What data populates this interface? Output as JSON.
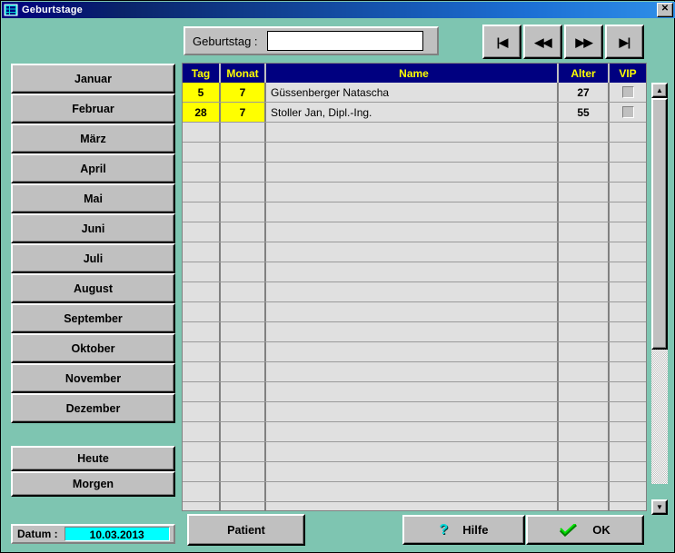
{
  "window": {
    "title": "Geburtstage",
    "icon": "list-table-icon",
    "close_label": "✕"
  },
  "search": {
    "label": "Geburtstag :",
    "value": "",
    "placeholder": ""
  },
  "nav": {
    "first": "|◀",
    "prev": "◀◀",
    "next": "▶▶",
    "last": "▶|"
  },
  "months": [
    {
      "label": "Januar"
    },
    {
      "label": "Februar"
    },
    {
      "label": "März"
    },
    {
      "label": "April"
    },
    {
      "label": "Mai"
    },
    {
      "label": "Juni"
    },
    {
      "label": "Juli"
    },
    {
      "label": "August"
    },
    {
      "label": "September"
    },
    {
      "label": "Oktober"
    },
    {
      "label": "November"
    },
    {
      "label": "Dezember"
    }
  ],
  "quick_days": [
    {
      "label": "Heute"
    },
    {
      "label": "Morgen"
    }
  ],
  "datum": {
    "label": "Datum :",
    "value": "10.03.2013"
  },
  "grid": {
    "columns": [
      {
        "key": "tag",
        "label": "Tag"
      },
      {
        "key": "monat",
        "label": "Monat"
      },
      {
        "key": "name",
        "label": "Name"
      },
      {
        "key": "alter",
        "label": "Alter"
      },
      {
        "key": "vip",
        "label": "VIP"
      }
    ],
    "rows": [
      {
        "tag": "5",
        "monat": "7",
        "name": "Güssenberger Natascha",
        "alter": "27",
        "vip": false
      },
      {
        "tag": "28",
        "monat": "7",
        "name": "Stoller Jan, Dipl.-Ing.",
        "alter": "55",
        "vip": false
      }
    ],
    "empty_row_count": 20
  },
  "scrollbar": {
    "up_arrow": "▲",
    "down_arrow": "▼"
  },
  "footer": {
    "patient": "Patient",
    "hilfe": "Hilfe",
    "hilfe_icon": "question-mark-icon",
    "ok": "OK",
    "ok_icon": "check-mark-icon"
  },
  "colors": {
    "background": "#7ec5b1",
    "titlebar_start": "#00007e",
    "titlebar_end": "#2f8fe8",
    "face": "#c0c0c0",
    "grid_header": "#000080",
    "grid_header_text": "#ffff00",
    "highlight_cell": "#ffff00",
    "date_field": "#00ffff",
    "row_bg": "#e0e0e0"
  }
}
